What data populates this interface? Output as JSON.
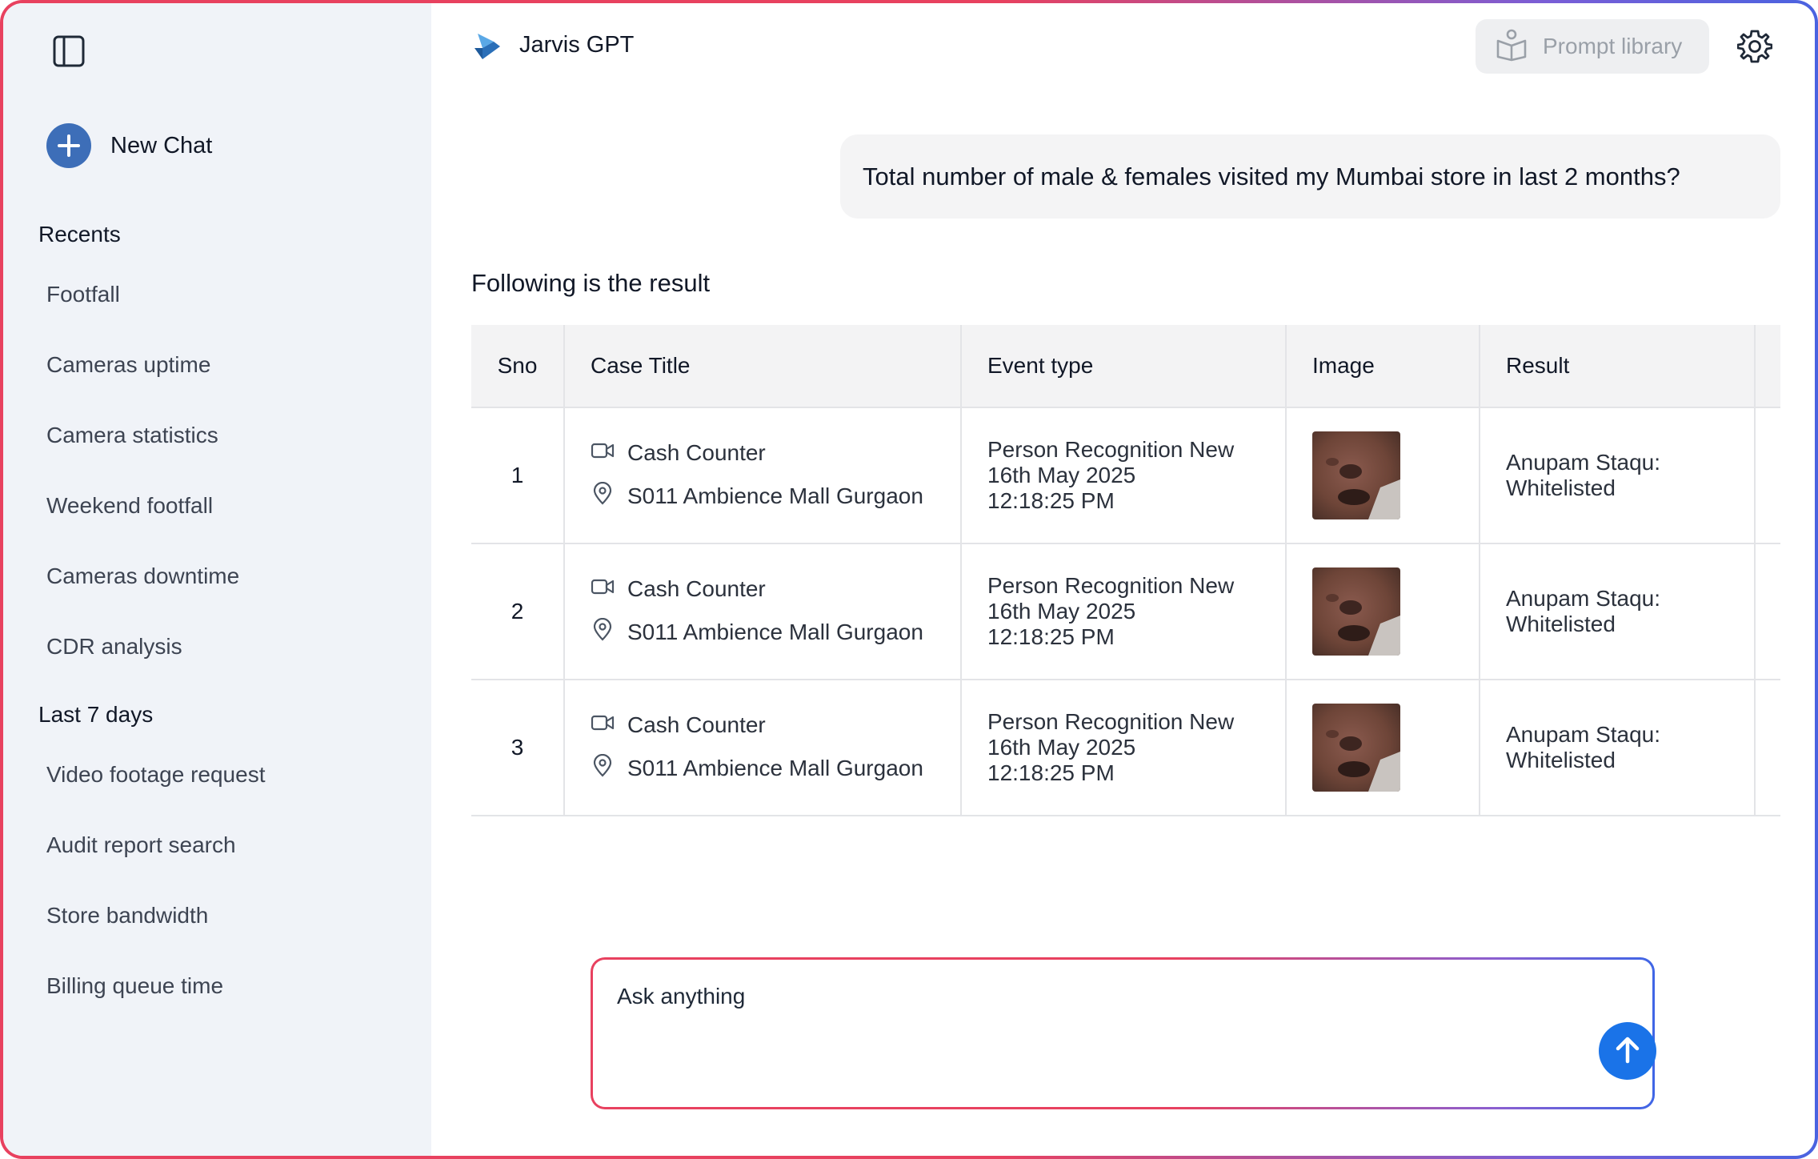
{
  "sidebar": {
    "new_chat_label": "New Chat",
    "recents_title": "Recents",
    "recents": [
      {
        "label": "Footfall"
      },
      {
        "label": "Cameras uptime"
      },
      {
        "label": "Camera statistics"
      },
      {
        "label": "Weekend footfall"
      },
      {
        "label": "Cameras downtime"
      },
      {
        "label": "CDR analysis"
      }
    ],
    "last7_title": "Last 7 days",
    "last7": [
      {
        "label": "Video footage request"
      },
      {
        "label": "Audit report search"
      },
      {
        "label": "Store bandwidth"
      },
      {
        "label": "Billing queue time"
      }
    ]
  },
  "header": {
    "title": "Jarvis GPT",
    "prompt_library_label": "Prompt library"
  },
  "chat": {
    "user_message": "Total number of male & females visited my Mumbai store in last 2 months?",
    "result_intro": "Following is the result"
  },
  "table": {
    "columns": [
      "Sno",
      "Case Title",
      "Event type",
      "Image",
      "Result"
    ],
    "rows": [
      {
        "sno": "1",
        "camera": "Cash Counter",
        "location": "S011 Ambience Mall Gurgaon",
        "event": "Person Recognition New",
        "date": "16th May 2025",
        "time": "12:18:25 PM",
        "result_line1": "Anupam Staqu:",
        "result_line2": "Whitelisted"
      },
      {
        "sno": "2",
        "camera": "Cash Counter",
        "location": "S011 Ambience Mall Gurgaon",
        "event": "Person Recognition New",
        "date": "16th May 2025",
        "time": "12:18:25 PM",
        "result_line1": "Anupam Staqu:",
        "result_line2": "Whitelisted"
      },
      {
        "sno": "3",
        "camera": "Cash Counter",
        "location": "S011 Ambience Mall Gurgaon",
        "event": "Person Recognition New",
        "date": "16th May 2025",
        "time": "12:18:25 PM",
        "result_line1": "Anupam Staqu:",
        "result_line2": "Whitelisted"
      }
    ]
  },
  "composer": {
    "placeholder": "Ask anything"
  },
  "icons": {
    "sidebar_toggle": "sidebar-toggle-icon",
    "new_chat": "plus-icon",
    "logo": "jarvis-logo-icon",
    "prompt_library": "book-icon",
    "settings": "gear-icon",
    "camera": "video-camera-icon",
    "location": "location-pin-icon",
    "send": "arrow-up-icon"
  },
  "colors": {
    "accent_blue": "#1a73e8",
    "new_chat_blue": "#3d6eb8",
    "sidebar_bg": "#f0f3f8",
    "gradient_pink": "#e8415f",
    "gradient_blue": "#4a63e0"
  }
}
